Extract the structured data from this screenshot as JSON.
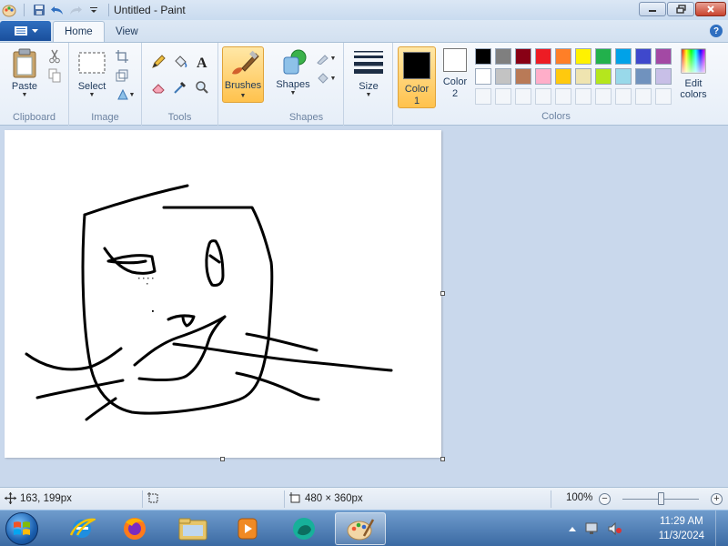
{
  "window": {
    "title": "Untitled - Paint"
  },
  "ribbon": {
    "tabs": [
      "Home",
      "View"
    ],
    "active_tab": "Home",
    "groups": {
      "clipboard": {
        "label": "Clipboard",
        "paste_label": "Paste"
      },
      "image": {
        "label": "Image",
        "select_label": "Select"
      },
      "tools": {
        "label": "Tools"
      },
      "brushes": {
        "label": "Brushes"
      },
      "shapes": {
        "label": "Shapes",
        "shapes_label": "Shapes"
      },
      "size": {
        "label": "Size"
      },
      "colors": {
        "label": "Colors",
        "color1_line1": "Color",
        "color1_line2": "1",
        "color2_line1": "Color",
        "color2_line2": "2",
        "edit_line1": "Edit",
        "edit_line2": "colors",
        "color1_value": "#000000",
        "color2_value": "#ffffff",
        "palette_row1": [
          "#000000",
          "#7f7f7f",
          "#880015",
          "#ed1c24",
          "#ff7f27",
          "#fff200",
          "#22b14c",
          "#00a2e8",
          "#3f48cc",
          "#a349a4"
        ],
        "palette_row2": [
          "#ffffff",
          "#c3c3c3",
          "#b97a57",
          "#ffaec9",
          "#ffc90e",
          "#efe4b0",
          "#b5e61d",
          "#99d9ea",
          "#7092be",
          "#c8bfe7"
        ]
      }
    }
  },
  "canvas": {
    "background": "#ffffff"
  },
  "statusbar": {
    "cursor_position": "163, 199px",
    "image_size": "480 × 360px",
    "zoom": "100%",
    "zoom_slider_fraction": 0.5
  },
  "taskbar": {
    "time": "11:29 AM",
    "date": "11/3/2024",
    "apps": [
      "Internet Explorer",
      "Firefox",
      "Windows Explorer",
      "Windows Media Player",
      "Windows Live Messenger",
      "Paint"
    ]
  }
}
